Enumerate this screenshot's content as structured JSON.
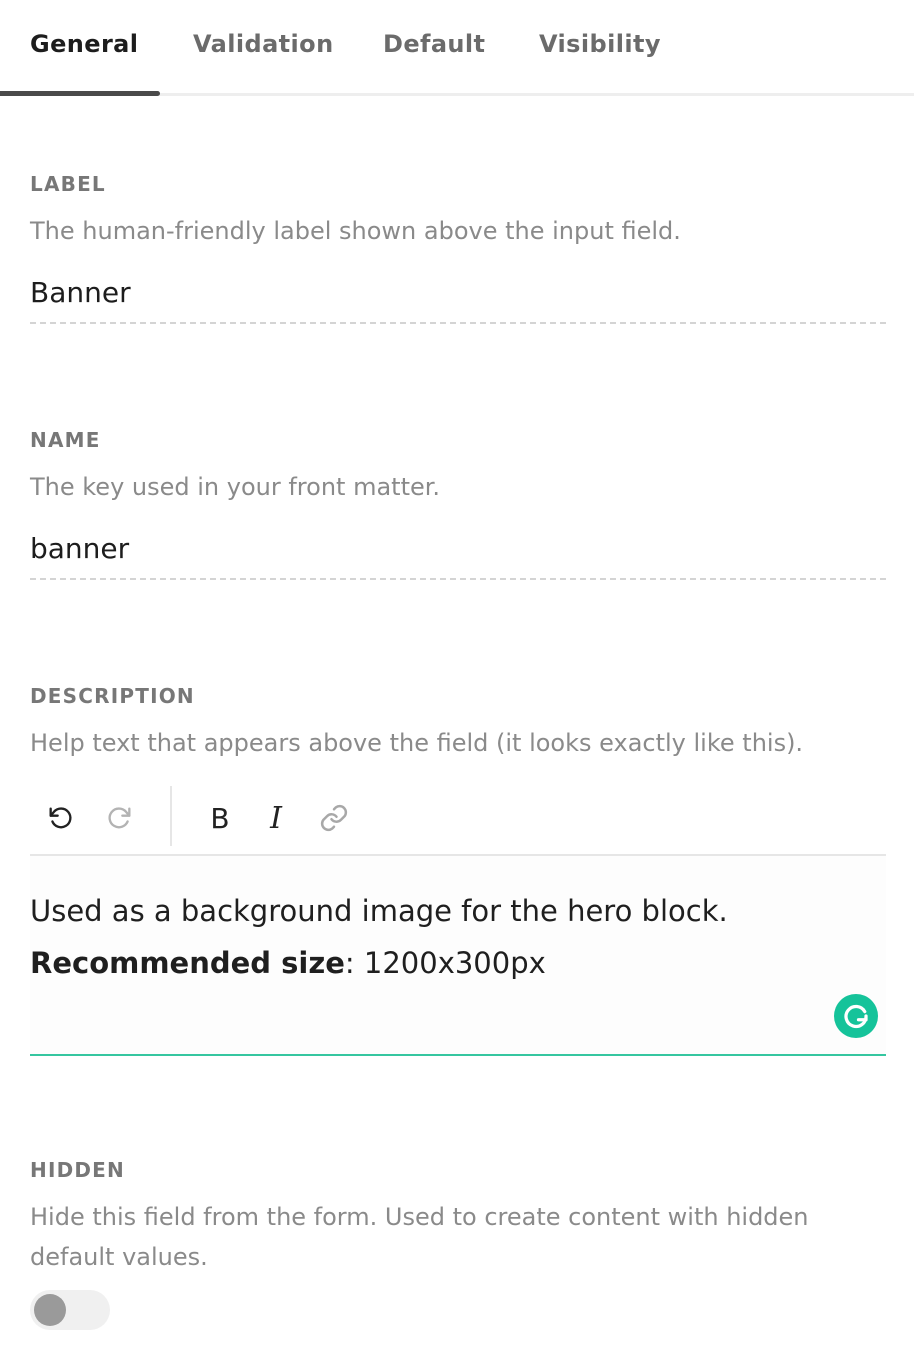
{
  "tabs": [
    {
      "label": "General",
      "active": true
    },
    {
      "label": "Validation",
      "active": false
    },
    {
      "label": "Default",
      "active": false
    },
    {
      "label": "Visibility",
      "active": false
    }
  ],
  "label_field": {
    "title": "LABEL",
    "help": "The human-friendly label shown above the input field.",
    "value": "Banner"
  },
  "name_field": {
    "title": "NAME",
    "help": "The key used in your front matter.",
    "value": "banner"
  },
  "description_field": {
    "title": "DESCRIPTION",
    "help": "Help text that appears above the field (it looks exactly like this).",
    "toolbar": {
      "undo_icon": "undo-icon",
      "redo_icon": "redo-icon",
      "bold_glyph": "B",
      "italic_glyph": "I",
      "link_icon": "link-icon"
    },
    "content_line1": "Used as a background image for the hero block.",
    "content_bold": "Recommended size",
    "content_rest": ": 1200x300px",
    "accent_color": "#35c6a0",
    "grammarly_color": "#15c39a"
  },
  "hidden_field": {
    "title": "HIDDEN",
    "help": "Hide this field from the form. Used to create content with hidden default values.",
    "enabled": false
  }
}
